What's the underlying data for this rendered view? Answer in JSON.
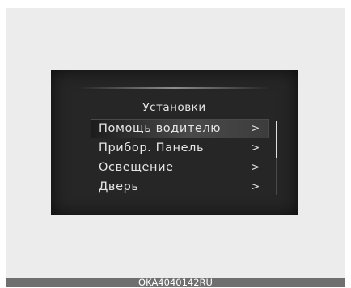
{
  "menu": {
    "title": "Установки",
    "items": [
      {
        "label": "Помощь водителю",
        "selected": true
      },
      {
        "label": "Прибор. Панель",
        "selected": false
      },
      {
        "label": "Освещение",
        "selected": false
      },
      {
        "label": "Дверь",
        "selected": false
      }
    ],
    "chevron": ">"
  },
  "scroll": {
    "position_fraction": 0,
    "visible_fraction": 0.5
  },
  "footer": {
    "code": "OKA4040142RU"
  },
  "colors": {
    "screen_background": "#262626",
    "page_background": "#ececec",
    "text": "#e6e6e6",
    "footer_bar": "#6f6f6f"
  }
}
